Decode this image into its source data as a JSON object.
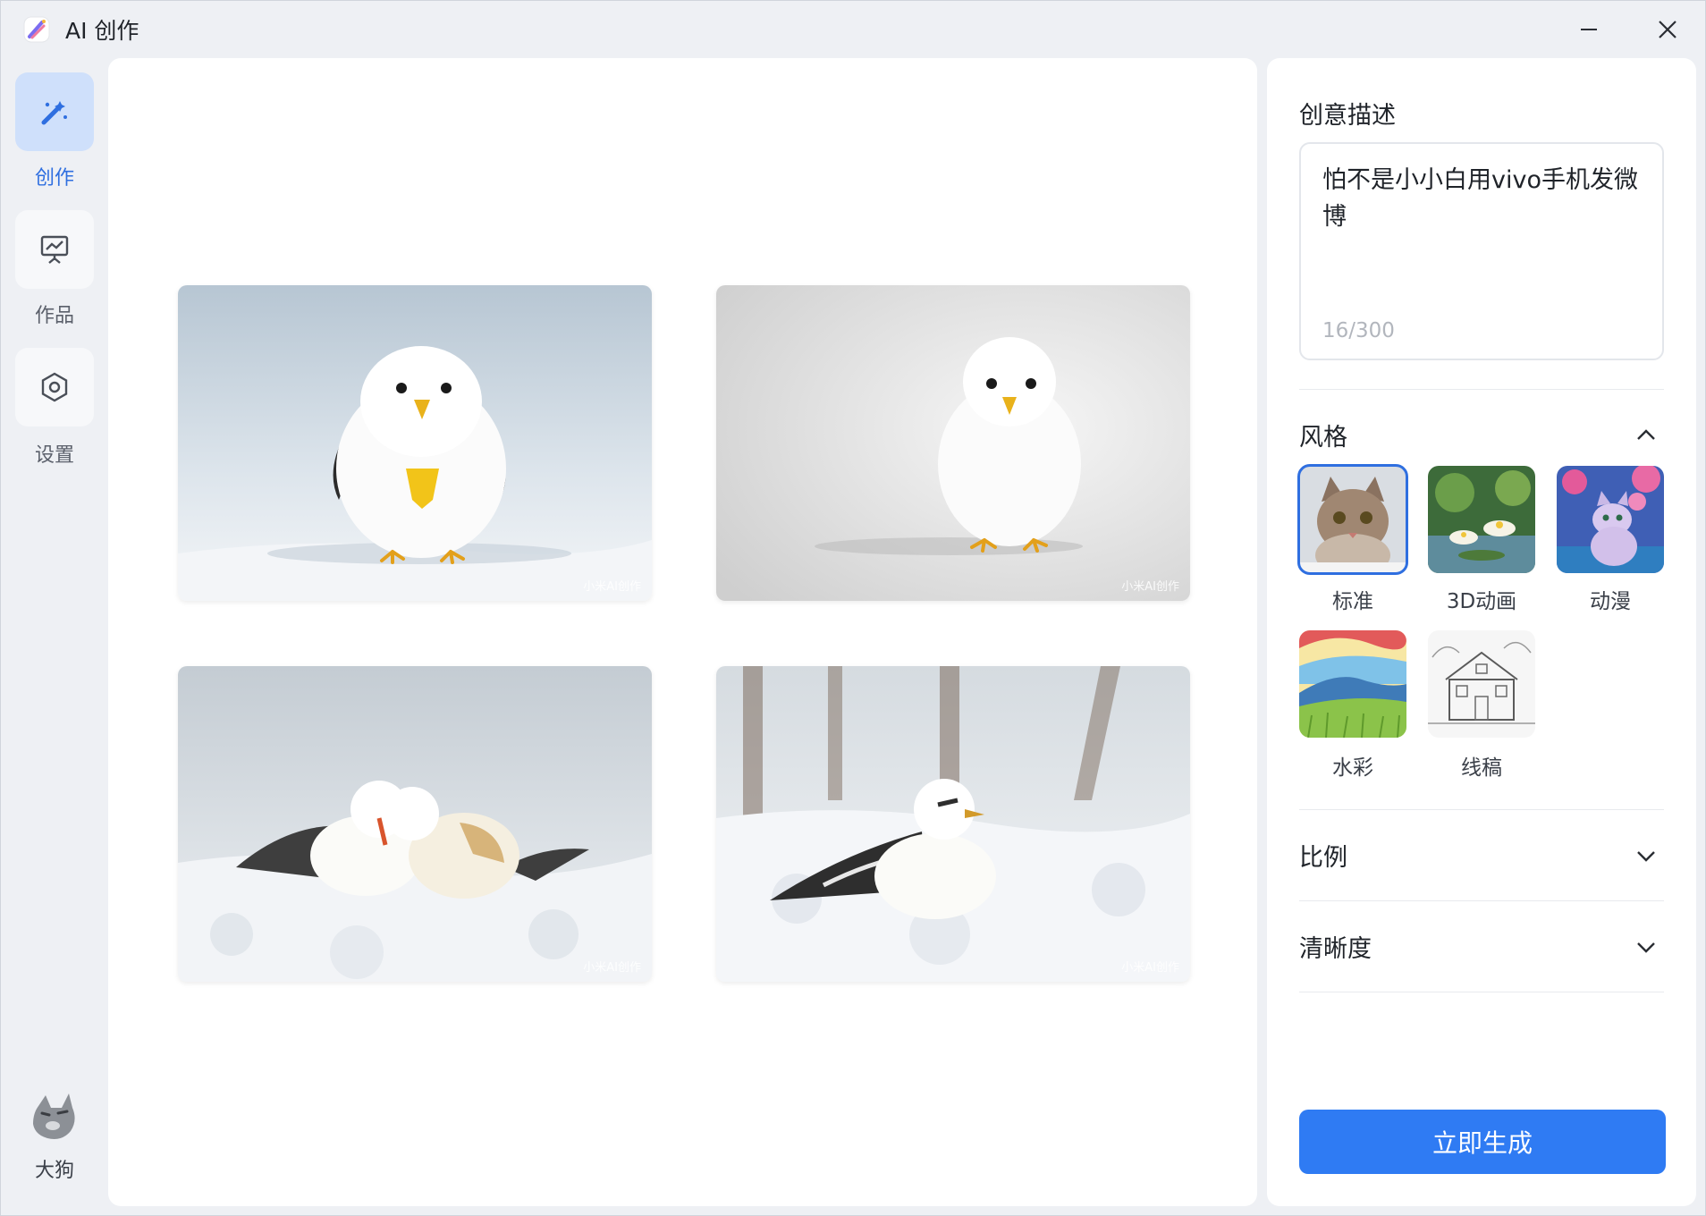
{
  "app": {
    "title": "AI 创作"
  },
  "nav": [
    {
      "label": "创作",
      "icon": "magic-wand-icon",
      "active": true
    },
    {
      "label": "作品",
      "icon": "presentation-icon",
      "active": false
    },
    {
      "label": "设置",
      "icon": "settings-hexagon-icon",
      "active": false
    }
  ],
  "user": {
    "name": "大狗"
  },
  "gallery": {
    "watermark": "小米AI创作",
    "images": [
      "fluffy-chick-front",
      "chick-gray-background",
      "two-birds-snow",
      "bird-snow-trees"
    ]
  },
  "panel": {
    "prompt_title": "创意描述",
    "prompt_text": "怕不是小小白用vivo手机发微博",
    "prompt_count": "16/300",
    "style_title": "风格",
    "styles": [
      {
        "label": "标准",
        "selected": true
      },
      {
        "label": "3D动画",
        "selected": false
      },
      {
        "label": "动漫",
        "selected": false
      },
      {
        "label": "水彩",
        "selected": false
      },
      {
        "label": "线稿",
        "selected": false
      }
    ],
    "ratio_title": "比例",
    "clarity_title": "清晰度",
    "generate_label": "立即生成"
  },
  "colors": {
    "accent": "#2f7bf3",
    "nav_active_bg": "#cfe0fb"
  }
}
